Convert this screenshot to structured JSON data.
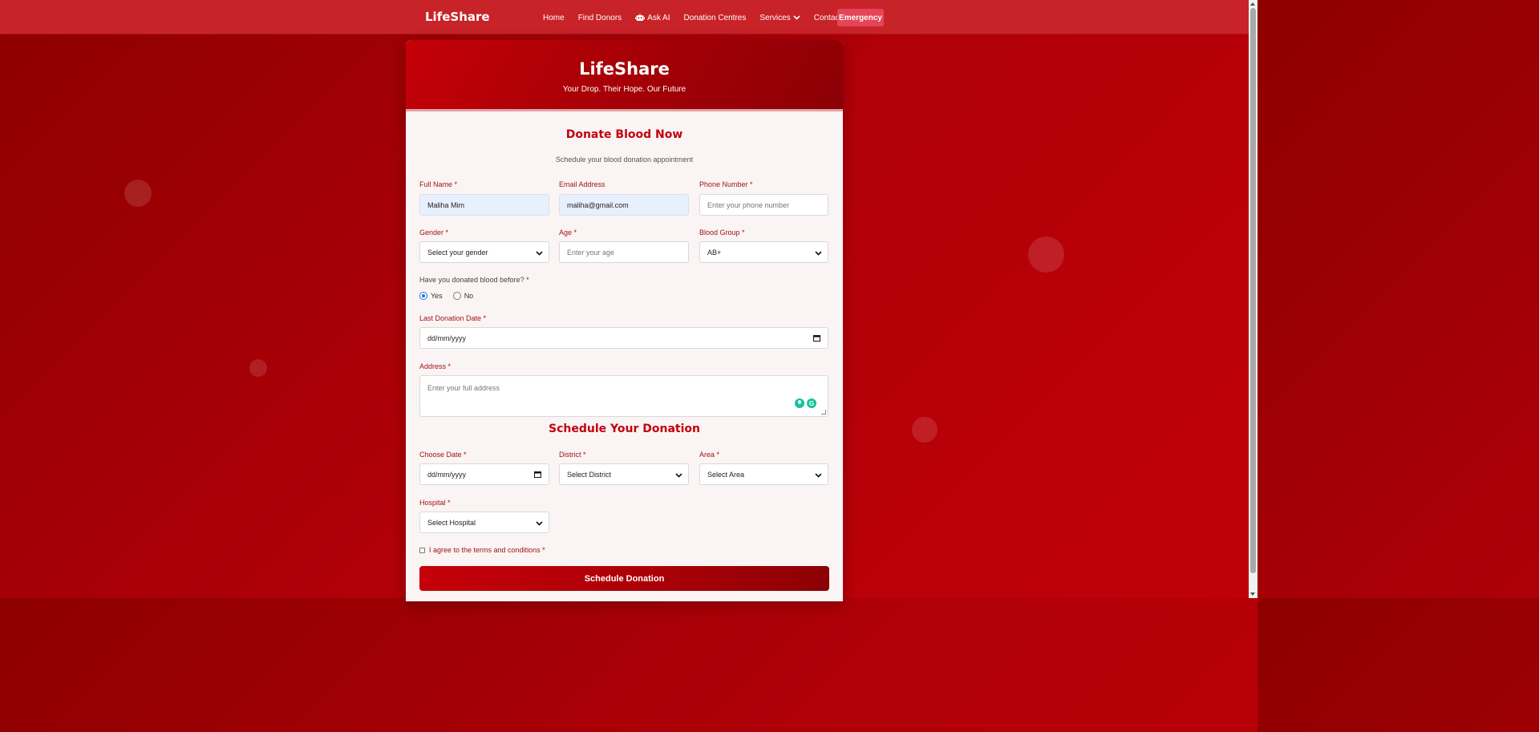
{
  "navbar": {
    "brand": "LifeShare",
    "links": [
      "Home",
      "Find Donors",
      "Ask AI",
      "Donation Centres",
      "Services",
      "Contact"
    ],
    "emergency": "Emergency"
  },
  "card": {
    "title": "LifeShare",
    "tagline": "Your Drop. Their Hope. Our Future"
  },
  "form": {
    "title": "Donate Blood Now",
    "subtitle": "Schedule your blood donation appointment",
    "full_name": {
      "label": "Full Name *",
      "value": "Maliha Mim"
    },
    "email": {
      "label": "Email Address",
      "value": "maliha@gmail.com"
    },
    "phone": {
      "label": "Phone Number *",
      "placeholder": "Enter your phone number"
    },
    "gender": {
      "label": "Gender *",
      "value": "Select your gender"
    },
    "age": {
      "label": "Age *",
      "placeholder": "Enter your age"
    },
    "blood_group": {
      "label": "Blood Group *",
      "value": "AB+"
    },
    "donated_before": {
      "label": "Have you donated blood before? *",
      "options": [
        "Yes",
        "No"
      ],
      "selected": "Yes"
    },
    "last_donation": {
      "label": "Last Donation Date *",
      "placeholder": "dd/mm/yyyy"
    },
    "address": {
      "label": "Address *",
      "placeholder": "Enter your full address"
    }
  },
  "schedule": {
    "title": "Schedule Your Donation",
    "date": {
      "label": "Choose Date *",
      "placeholder": "dd/mm/yyyy"
    },
    "district": {
      "label": "District *",
      "value": "Select District"
    },
    "area": {
      "label": "Area *",
      "value": "Select Area"
    },
    "hospital": {
      "label": "Hospital *",
      "value": "Select Hospital"
    },
    "terms": "I agree to the terms and conditions *",
    "submit": "Schedule Donation"
  },
  "colors": {
    "primary_red": "#c2000b",
    "navbar_red": "#c82328",
    "emergency": "#e54556",
    "autofill_blue": "#e8f0fe"
  }
}
